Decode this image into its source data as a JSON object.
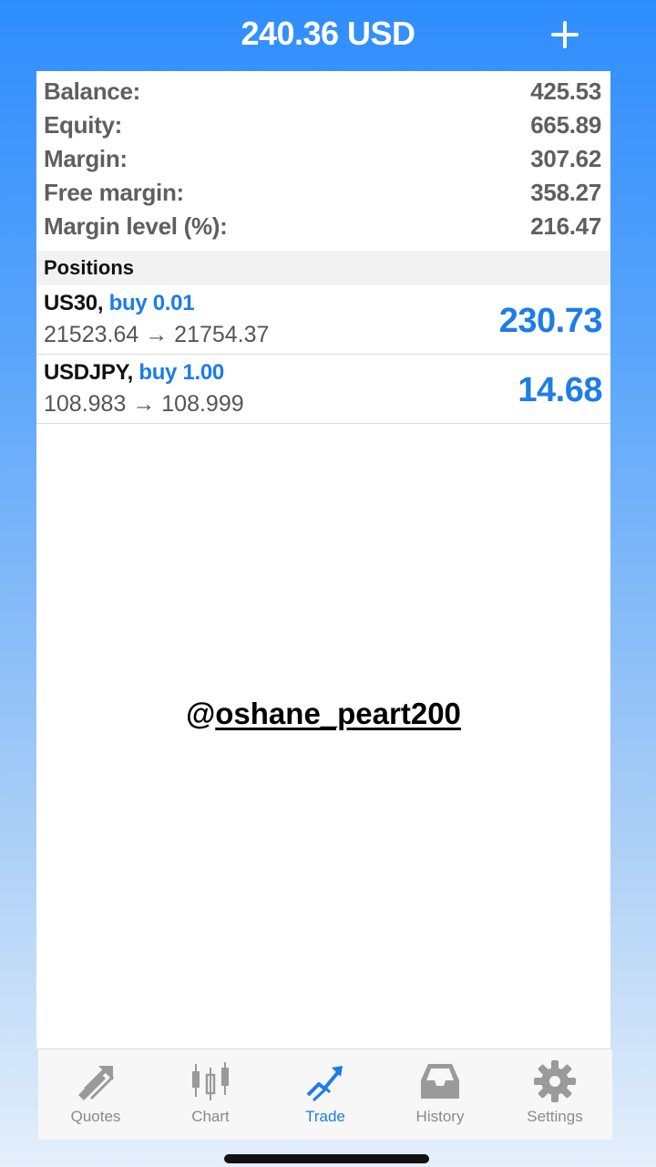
{
  "header": {
    "title": "240.36 USD"
  },
  "account": [
    {
      "label": "Balance:",
      "value": "425.53"
    },
    {
      "label": "Equity:",
      "value": "665.89"
    },
    {
      "label": "Margin:",
      "value": "307.62"
    },
    {
      "label": "Free margin:",
      "value": "358.27"
    },
    {
      "label": "Margin level (%):",
      "value": "216.47"
    }
  ],
  "positions": {
    "title": "Positions",
    "items": [
      {
        "symbol": "US30,",
        "side": "buy 0.01",
        "prices": "21523.64 → 21754.37",
        "profit": "230.73"
      },
      {
        "symbol": "USDJPY,",
        "side": "buy 1.00",
        "prices": "108.983 → 108.999",
        "profit": "14.68"
      }
    ]
  },
  "watermark": {
    "at": "@",
    "handle": "oshane_peart200"
  },
  "tabs": [
    {
      "label": "Quotes",
      "icon": "quotes-icon"
    },
    {
      "label": "Chart",
      "icon": "candlestick-icon"
    },
    {
      "label": "Trade",
      "icon": "trade-icon",
      "active": true
    },
    {
      "label": "History",
      "icon": "inbox-icon"
    },
    {
      "label": "Settings",
      "icon": "gear-icon"
    }
  ],
  "colors": {
    "accent": "#1b7de8",
    "header": "#2e8dfd"
  }
}
